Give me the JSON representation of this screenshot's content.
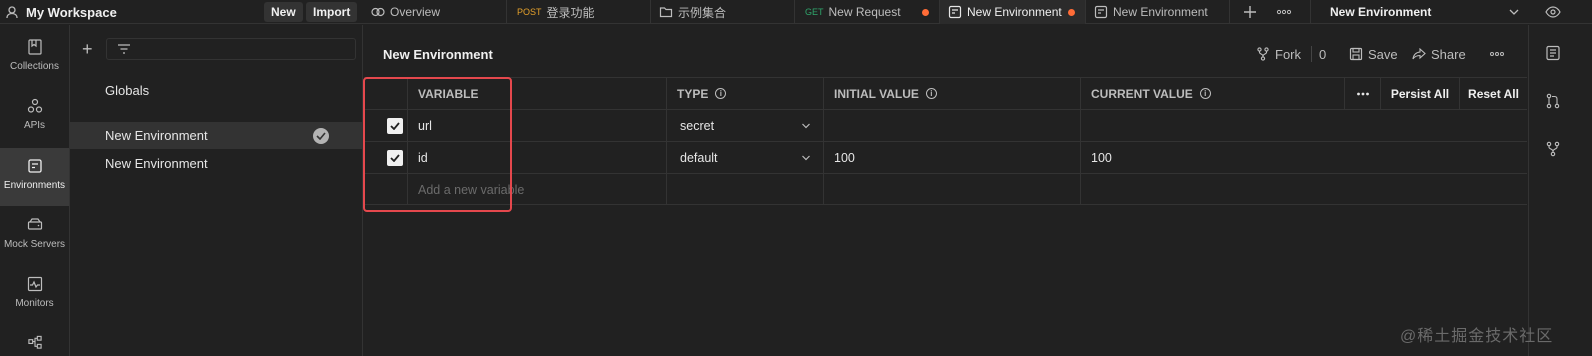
{
  "workspace": {
    "name": "My Workspace",
    "new_label": "New",
    "import_label": "Import"
  },
  "tabs": [
    {
      "label": "Overview",
      "icon": "overview-icon"
    },
    {
      "method": "POST",
      "label": "登录功能",
      "method_color": "#e5a12b"
    },
    {
      "label": "示例集合",
      "icon": "collection-icon"
    },
    {
      "method": "GET",
      "label": "New Request",
      "method_color": "#2fa56b",
      "unsaved": true
    },
    {
      "label": "New Environment",
      "icon": "environment-icon",
      "active": true,
      "unsaved": true
    },
    {
      "label": "New Environment",
      "icon": "environment-icon"
    }
  ],
  "env_selector": {
    "value": "New Environment"
  },
  "rail": [
    {
      "label": "Collections",
      "icon": "collections-icon"
    },
    {
      "label": "APIs",
      "icon": "apis-icon"
    },
    {
      "label": "Environments",
      "icon": "environments-icon",
      "active": true
    },
    {
      "label": "Mock Servers",
      "icon": "mock-servers-icon"
    },
    {
      "label": "Monitors",
      "icon": "monitors-icon"
    }
  ],
  "sidebar": {
    "globals_label": "Globals",
    "items": [
      {
        "label": "New Environment",
        "active": true
      },
      {
        "label": "New Environment"
      }
    ]
  },
  "main": {
    "title": "New Environment",
    "fork_label": "Fork",
    "fork_count": "0",
    "save_label": "Save",
    "share_label": "Share",
    "columns": {
      "variable": "VARIABLE",
      "type": "TYPE",
      "initial": "INITIAL VALUE",
      "current": "CURRENT VALUE",
      "persist_all": "Persist All",
      "reset_all": "Reset All"
    },
    "rows": [
      {
        "checked": true,
        "variable": "url",
        "type": "secret",
        "initial": "",
        "current": ""
      },
      {
        "checked": true,
        "variable": "id",
        "type": "default",
        "initial": "100",
        "current": "100"
      }
    ],
    "add_placeholder": "Add a new variable"
  },
  "colors": {
    "accent": "#ff6c37",
    "highlight": "#e5484d"
  },
  "watermark": "@稀土掘金技术社区"
}
